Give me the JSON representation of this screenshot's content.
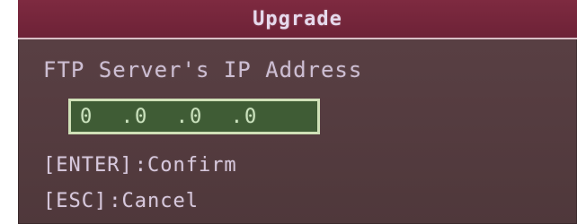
{
  "dialog": {
    "title": "Upgrade",
    "field_label": "FTP Server's IP Address",
    "ip_address": "0  .0  .0  .0"
  },
  "hints": {
    "confirm_key": "[ENTER]",
    "confirm_text": ":Confirm",
    "cancel_key": "[ESC]",
    "cancel_text": ":Cancel"
  },
  "colors": {
    "title_bar": "#7E2A40",
    "dialog_background": "#553C40",
    "input_background": "#3F5C35",
    "input_border": "#CFE0B7",
    "text": "#D7C8DD"
  }
}
